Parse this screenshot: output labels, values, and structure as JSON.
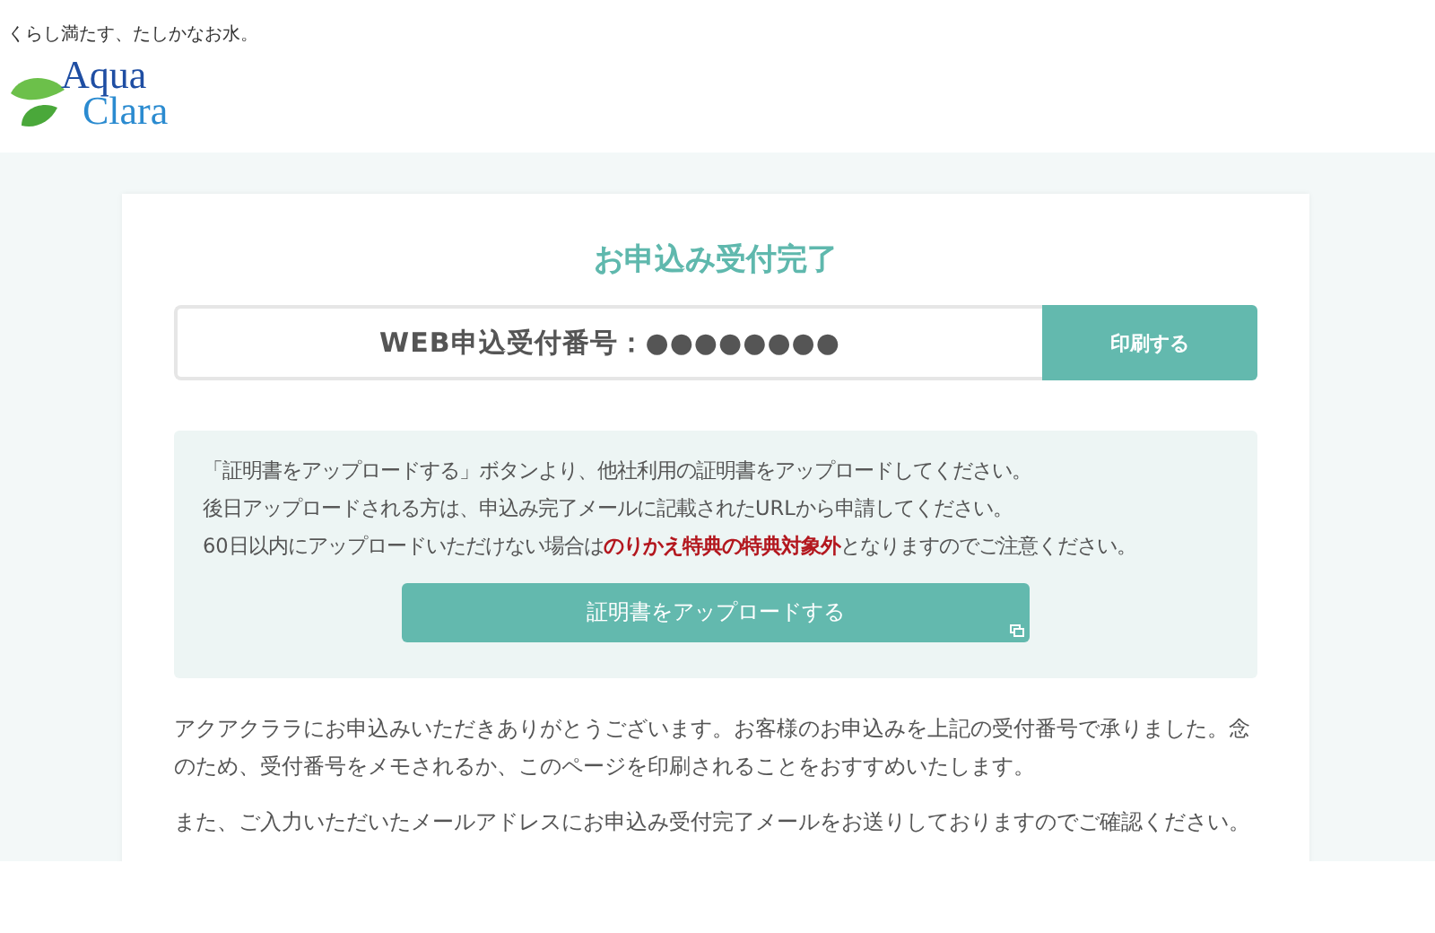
{
  "header": {
    "tagline": "くらし満たす、たしかなお水。",
    "logo_line_1": "Aqua",
    "logo_line_2": "Clara"
  },
  "title": "お申込み受付完了",
  "receipt": {
    "label": "WEB申込受付番号：●●●●●●●●",
    "print_button": "印刷する"
  },
  "notice": {
    "lines": [
      "「証明書をアップロードする」ボタンより、他社利用の証明書をアップロードしてください。",
      "後日アップロードされる方は、申込み完了メールに記載されたURLから申請してください。",
      "60日以内にアップロードいただけない場合は**のりかえ特典の特典対象外**となりますのでご注意ください。"
    ],
    "upload_button": "証明書をアップロードする"
  },
  "paragraphs": [
    "アクアクララにお申込みいただきありがとうございます。お客様のお申込みを上記の受付番号で承りました。念のため、受付番号をメモされるか、このページを印刷されることをおすすめいたします。",
    "また、ご入力いただいたメールアドレスにお申込み受付完了メールをお送りしておりますのでご確認ください。"
  ]
}
